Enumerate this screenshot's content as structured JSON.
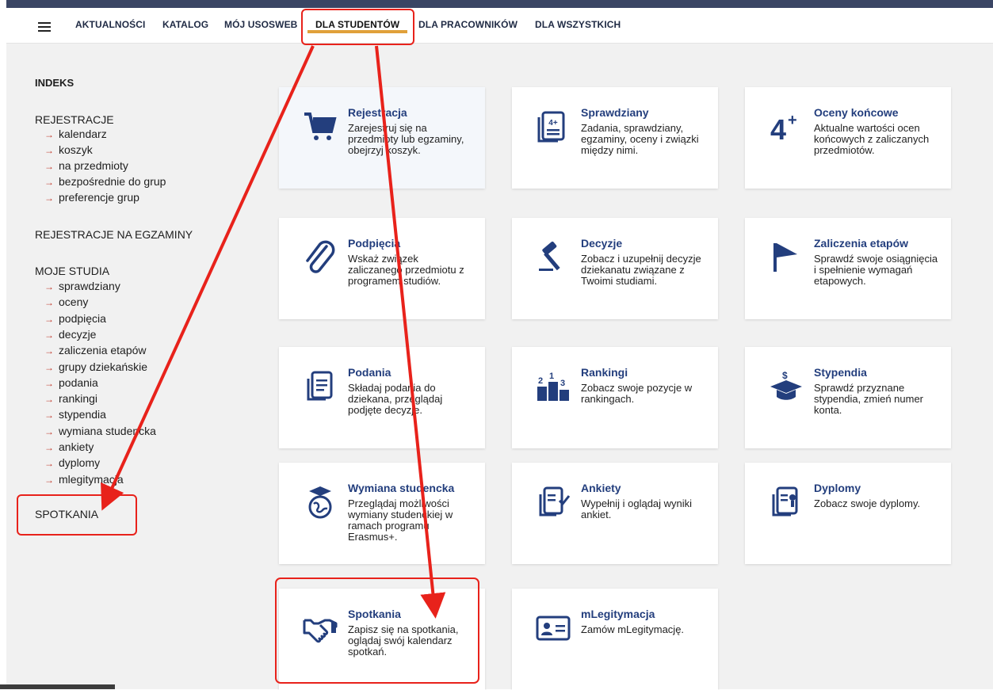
{
  "nav": {
    "items": [
      "AKTUALNOŚCI",
      "KATALOG",
      "MÓJ USOSWEB",
      "DLA STUDENTÓW",
      "DLA PRACOWNIKÓW",
      "DLA WSZYSTKICH"
    ],
    "active": "DLA STUDENTÓW"
  },
  "sidebar": {
    "indeks": "INDEKS",
    "rejestracje": "REJESTRACJE",
    "rejestracje_items": [
      "kalendarz",
      "koszyk",
      "na przedmioty",
      "bezpośrednie do grup",
      "preferencje grup"
    ],
    "rejestracje_egz": "REJESTRACJE NA EGZAMINY",
    "moje_studia": "MOJE STUDIA",
    "moje_studia_items": [
      "sprawdziany",
      "oceny",
      "podpięcia",
      "decyzje",
      "zaliczenia etapów",
      "grupy dziekańskie",
      "podania",
      "rankingi",
      "stypendia",
      "wymiana studencka",
      "ankiety",
      "dyplomy",
      "mlegitymacja"
    ],
    "spotkania": "SPOTKANIA"
  },
  "cards": [
    {
      "title": "Rejestracja",
      "desc": "Zarejestruj się na przedmioty lub egzaminy, obejrzyj koszyk.",
      "icon": "cart-icon"
    },
    {
      "title": "Sprawdziany",
      "desc": "Zadania, sprawdziany, egzaminy, oceny i związki między nimi.",
      "icon": "tests-icon"
    },
    {
      "title": "Oceny końcowe",
      "desc": "Aktualne wartości ocen końcowych z zaliczanych przedmiotów.",
      "icon": "grade-icon"
    },
    {
      "title": "Podpięcia",
      "desc": "Wskaż związek zaliczanego przedmiotu z programem studiów.",
      "icon": "paperclip-icon"
    },
    {
      "title": "Decyzje",
      "desc": "Zobacz i uzupełnij decyzje dziekanatu związane z Twoimi studiami.",
      "icon": "gavel-icon"
    },
    {
      "title": "Zaliczenia etapów",
      "desc": "Sprawdź swoje osiągnięcia i spełnienie wymagań etapowych.",
      "icon": "flag-icon"
    },
    {
      "title": "Podania",
      "desc": "Składaj podania do dziekana, przeglądaj podjęte decyzje.",
      "icon": "document-icon"
    },
    {
      "title": "Rankingi",
      "desc": "Zobacz swoje pozycje w rankingach.",
      "icon": "podium-icon"
    },
    {
      "title": "Stypendia",
      "desc": "Sprawdź przyznane stypendia, zmień numer konta.",
      "icon": "scholarship-icon"
    },
    {
      "title": "Wymiana studencka",
      "desc": "Przeglądaj możliwości wymiany studenckiej w ramach programu Erasmus+.",
      "icon": "globe-icon"
    },
    {
      "title": "Ankiety",
      "desc": "Wypełnij i oglądaj wyniki ankiet.",
      "icon": "survey-icon"
    },
    {
      "title": "Dyplomy",
      "desc": "Zobacz swoje dyplomy.",
      "icon": "diploma-icon"
    },
    {
      "title": "Spotkania",
      "desc": "Zapisz się na spotkania, oglądaj swój kalendarz spotkań.",
      "icon": "handshake-icon"
    },
    {
      "title": "mLegitymacja",
      "desc": "Zamów mLegitymację.",
      "icon": "id-card-icon"
    }
  ],
  "annotation_color": "#e8221b"
}
